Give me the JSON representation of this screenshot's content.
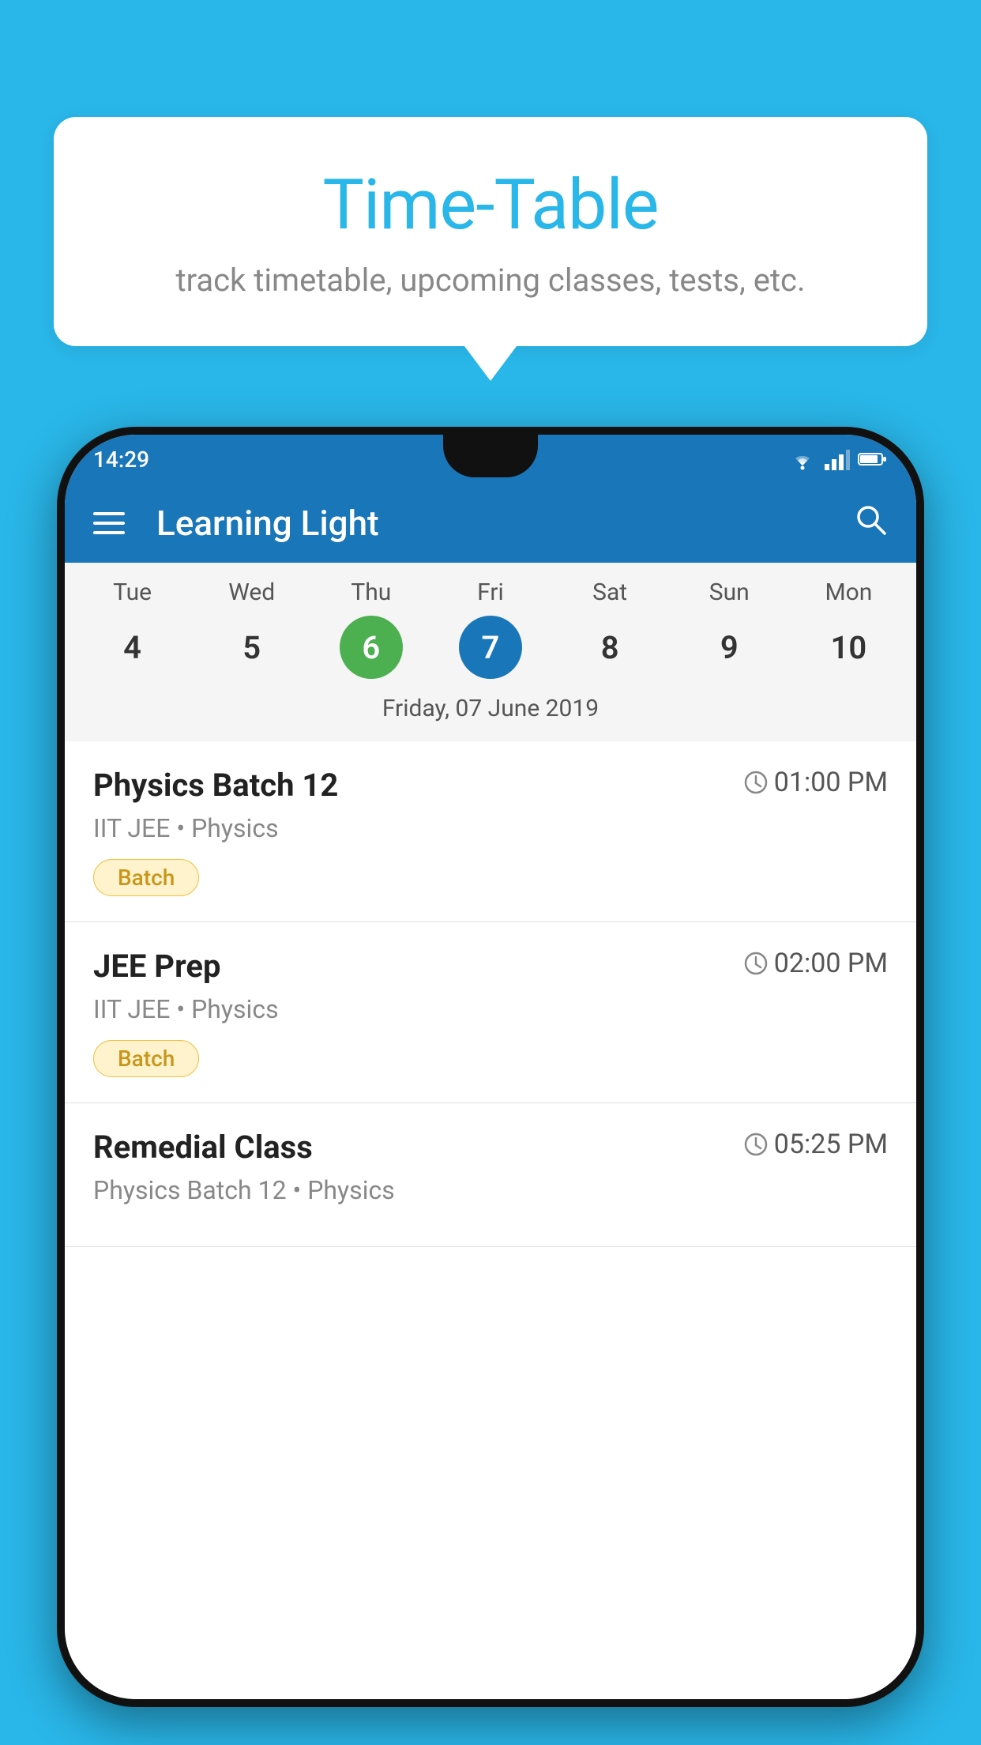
{
  "background": {
    "color": "#29b6e8"
  },
  "speech_bubble": {
    "title": "Time-Table",
    "subtitle": "track timetable, upcoming classes, tests, etc."
  },
  "phone": {
    "status_bar": {
      "time": "14:29"
    },
    "app_bar": {
      "title": "Learning Light"
    },
    "calendar": {
      "days": [
        {
          "label": "Tue",
          "number": "4",
          "state": "normal"
        },
        {
          "label": "Wed",
          "number": "5",
          "state": "normal"
        },
        {
          "label": "Thu",
          "number": "6",
          "state": "today"
        },
        {
          "label": "Fri",
          "number": "7",
          "state": "selected"
        },
        {
          "label": "Sat",
          "number": "8",
          "state": "normal"
        },
        {
          "label": "Sun",
          "number": "9",
          "state": "normal"
        },
        {
          "label": "Mon",
          "number": "10",
          "state": "normal"
        }
      ],
      "date_label": "Friday, 07 June 2019"
    },
    "schedule": {
      "items": [
        {
          "title": "Physics Batch 12",
          "time": "01:00 PM",
          "subtitle": "IIT JEE • Physics",
          "tag": "Batch"
        },
        {
          "title": "JEE Prep",
          "time": "02:00 PM",
          "subtitle": "IIT JEE • Physics",
          "tag": "Batch"
        },
        {
          "title": "Remedial Class",
          "time": "05:25 PM",
          "subtitle": "Physics Batch 12 • Physics",
          "tag": null
        }
      ]
    }
  }
}
